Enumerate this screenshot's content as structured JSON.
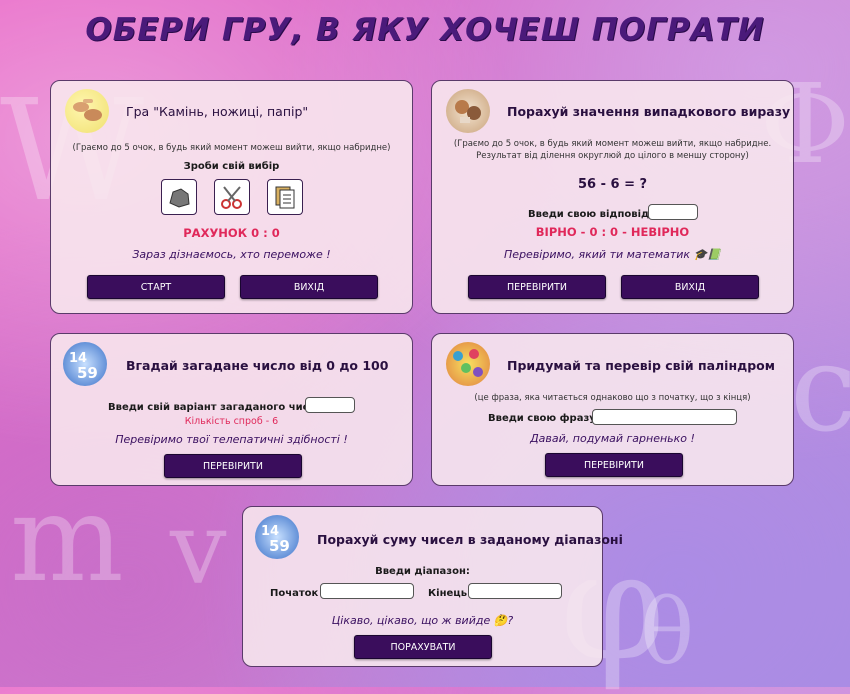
{
  "page": {
    "title": "ОБЕРИ ГРУ, В ЯКУ ХОЧЕШ ПОГРАТИ"
  },
  "rps": {
    "title": "Гра \"Камінь, ножиці, папір\"",
    "hint": "(Граємо до 5 очок, в будь який момент можеш вийти, якщо набридне)",
    "choose_label": "Зроби свій вибір",
    "choices": [
      "rock-icon",
      "scissors-icon",
      "paper-icon"
    ],
    "score": "РАХУНОК 0 : 0",
    "status": "Зараз дізнаємось, хто переможе !",
    "start_label": "СТАРТ",
    "exit_label": "ВИХІД"
  },
  "math": {
    "title": "Порахуй значення випадкового виразу",
    "hint1": "(Граємо до 5 очок, в будь який момент можеш вийти, якщо набридне.",
    "hint2": "Результат від ділення округлюй до цілого в меншу сторону)",
    "expression": "56 - 6 = ?",
    "answer_label": "Введи свою відповідь",
    "score": "ВІРНО - 0 : 0 - НЕВІРНО",
    "status": "Перевіримо, який ти математик 🎓📗",
    "check_label": "ПЕРЕВІРИТИ",
    "exit_label": "ВИХІД"
  },
  "guess": {
    "title": "Вгадай загадане число від 0 до 100",
    "input_label": "Введи свій варіант загаданого числа",
    "attempts": "Кількість спроб - 6",
    "status": "Перевіримо твої телепатичні здібності !",
    "check_label": "ПЕРЕВІРИТИ"
  },
  "palindrome": {
    "title": "Придумай та перевір свій паліндром",
    "hint": "(це фраза, яка читається однаково що з початку, що з кінця)",
    "input_label": "Введи свою фразу",
    "status": "Давай, подумай гарненько !",
    "check_label": "ПЕРЕВІРИТИ"
  },
  "sum": {
    "title": "Порахуй суму чисел в заданому діапазоні",
    "range_label": "Введи діапазон:",
    "start_label": "Початок",
    "end_label": "Кінець",
    "status": "Цікаво, цікаво, що ж вийде 🤔?",
    "calc_label": "ПОРАХУВАТИ"
  },
  "colors": {
    "accent": "#3a0d5c",
    "score": "#e0285a",
    "title": "#4a1a7a"
  }
}
